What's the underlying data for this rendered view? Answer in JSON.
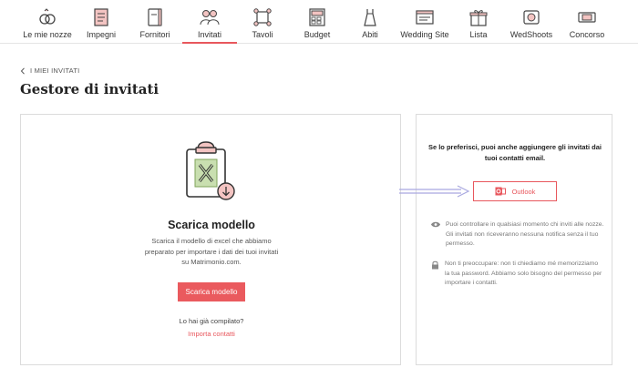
{
  "nav": {
    "items": [
      {
        "label": "Le mie nozze",
        "icon": "rings-icon"
      },
      {
        "label": "Impegni",
        "icon": "checklist-icon"
      },
      {
        "label": "Fornitori",
        "icon": "vendors-icon"
      },
      {
        "label": "Invitati",
        "icon": "guests-icon",
        "active": true
      },
      {
        "label": "Tavoli",
        "icon": "tables-icon"
      },
      {
        "label": "Budget",
        "icon": "calculator-icon"
      },
      {
        "label": "Abiti",
        "icon": "dress-icon"
      },
      {
        "label": "Wedding Site",
        "icon": "website-icon"
      },
      {
        "label": "Lista",
        "icon": "gift-icon"
      },
      {
        "label": "WedShoots",
        "icon": "camera-icon"
      },
      {
        "label": "Concorso",
        "icon": "ticket-icon"
      }
    ]
  },
  "breadcrumb": "I MIEI INVITATI",
  "page_title": "Gestore di invitati",
  "download_card": {
    "title": "Scarica modello",
    "description": "Scarica il modello di excel che abbiamo preparato per importare i dati dei tuoi invitati su Matrimonio.com.",
    "button_label": "Scarica modello",
    "question": "Lo hai già compilato?",
    "link_label": "Importa contatti"
  },
  "contacts_card": {
    "heading": "Se lo preferisci, puoi anche aggiungere gli invitati dai tuoi contatti email.",
    "outlook_label": "Outlook",
    "note_privacy": "Puoi controllare in qualsiasi momento chi inviti alle nozze. Gli invitati non riceveranno nessuna notifica senza il tuo permesso.",
    "note_password": "Non ti preoccupare: non ti chiediamo mé memorizziamo la tua password. Abbiamo solo bisogno del permesso per importare i contatti."
  },
  "colors": {
    "accent": "#e8575d",
    "icon_stroke": "#444444",
    "icon_fill": "#f3c4c2",
    "excel_green": "#7fa35a",
    "arrow": "#a9a8e0"
  }
}
